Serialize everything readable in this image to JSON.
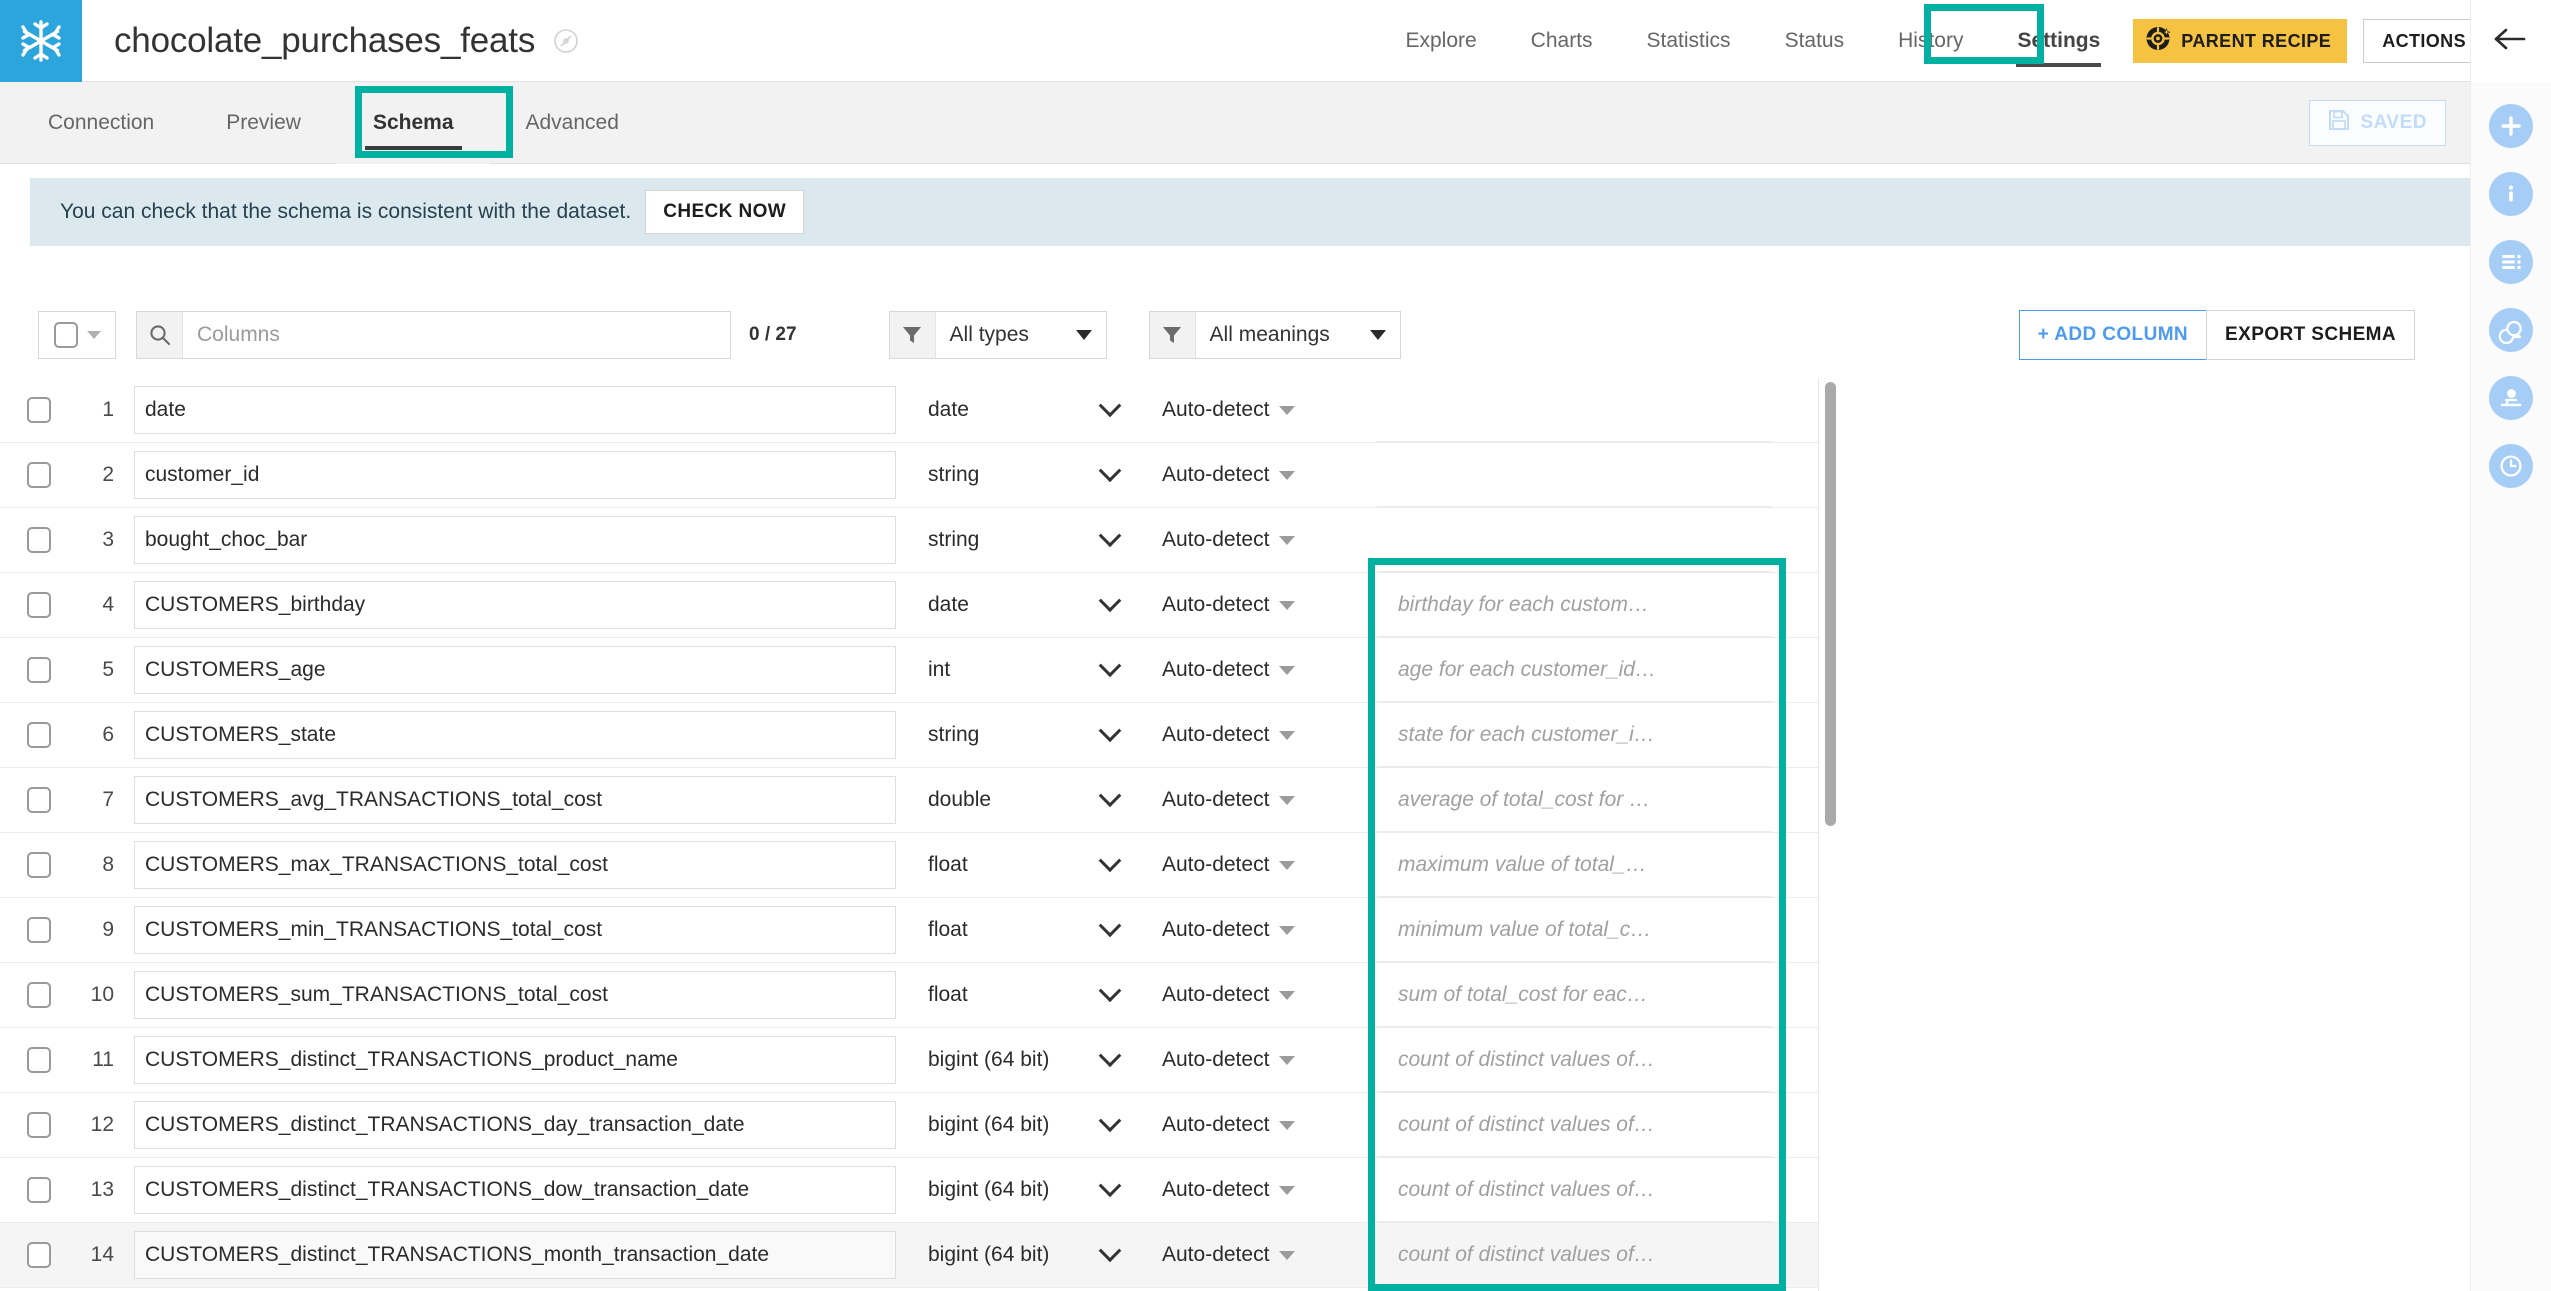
{
  "app": {
    "logo_icon": "snowflake-icon",
    "title": "chocolate_purchases_feats",
    "title_badge_icon": "compass-badge-icon",
    "accent_teal": "#00b0a0",
    "logo_bg": "#2ca5dd",
    "parent_recipe_bg": "#f5c242",
    "add_column_color": "#4d9bf0"
  },
  "topnav": {
    "items": [
      {
        "label": "Explore",
        "active": false
      },
      {
        "label": "Charts",
        "active": false
      },
      {
        "label": "Statistics",
        "active": false
      },
      {
        "label": "Status",
        "active": false
      },
      {
        "label": "History",
        "active": false
      },
      {
        "label": "Settings",
        "active": true
      }
    ],
    "parent_recipe_label": "PARENT RECIPE",
    "parent_recipe_icon": "gear-sparkle-icon",
    "actions_label": "ACTIONS",
    "back_arrow_icon": "arrow-left-icon"
  },
  "subtabs": {
    "items": [
      {
        "label": "Connection",
        "active": false
      },
      {
        "label": "Preview",
        "active": false
      },
      {
        "label": "Schema",
        "active": true
      },
      {
        "label": "Advanced",
        "active": false
      }
    ],
    "saved_label": "SAVED",
    "saved_icon": "floppy-disk-icon"
  },
  "banner": {
    "text": "You can check that the schema is consistent with the dataset.",
    "button_label": "CHECK NOW"
  },
  "toolbar": {
    "select_all_icon": "checkbox-icon",
    "select_all_caret_icon": "caret-down-icon",
    "search_icon": "search-icon",
    "search_placeholder": "Columns",
    "search_value": "",
    "count": "0 / 27",
    "filter_icon": "filter-funnel-icon",
    "types_filter": "All types",
    "meanings_filter": "All meanings",
    "add_column_label": "+ ADD COLUMN",
    "export_schema_label": "EXPORT SCHEMA"
  },
  "table": {
    "rows": [
      {
        "num": "1",
        "name": "date",
        "type": "date",
        "meaning": "Auto-detect",
        "desc": ""
      },
      {
        "num": "2",
        "name": "customer_id",
        "type": "string",
        "meaning": "Auto-detect",
        "desc": ""
      },
      {
        "num": "3",
        "name": "bought_choc_bar",
        "type": "string",
        "meaning": "Auto-detect",
        "desc": ""
      },
      {
        "num": "4",
        "name": "CUSTOMERS_birthday",
        "type": "date",
        "meaning": "Auto-detect",
        "desc": "birthday for each custom…"
      },
      {
        "num": "5",
        "name": "CUSTOMERS_age",
        "type": "int",
        "meaning": "Auto-detect",
        "desc": "age for each customer_id…"
      },
      {
        "num": "6",
        "name": "CUSTOMERS_state",
        "type": "string",
        "meaning": "Auto-detect",
        "desc": "state for each customer_i…"
      },
      {
        "num": "7",
        "name": "CUSTOMERS_avg_TRANSACTIONS_total_cost",
        "type": "double",
        "meaning": "Auto-detect",
        "desc": "average of total_cost for …"
      },
      {
        "num": "8",
        "name": "CUSTOMERS_max_TRANSACTIONS_total_cost",
        "type": "float",
        "meaning": "Auto-detect",
        "desc": "maximum value of total_…"
      },
      {
        "num": "9",
        "name": "CUSTOMERS_min_TRANSACTIONS_total_cost",
        "type": "float",
        "meaning": "Auto-detect",
        "desc": "minimum value of total_c…"
      },
      {
        "num": "10",
        "name": "CUSTOMERS_sum_TRANSACTIONS_total_cost",
        "type": "float",
        "meaning": "Auto-detect",
        "desc": "sum of total_cost for eac…"
      },
      {
        "num": "11",
        "name": "CUSTOMERS_distinct_TRANSACTIONS_product_name",
        "type": "bigint (64 bit)",
        "meaning": "Auto-detect",
        "desc": "count of distinct values of…"
      },
      {
        "num": "12",
        "name": "CUSTOMERS_distinct_TRANSACTIONS_day_transaction_date",
        "type": "bigint (64 bit)",
        "meaning": "Auto-detect",
        "desc": "count of distinct values of…"
      },
      {
        "num": "13",
        "name": "CUSTOMERS_distinct_TRANSACTIONS_dow_transaction_date",
        "type": "bigint (64 bit)",
        "meaning": "Auto-detect",
        "desc": "count of distinct values of…"
      },
      {
        "num": "14",
        "name": "CUSTOMERS_distinct_TRANSACTIONS_month_transaction_date",
        "type": "bigint (64 bit)",
        "meaning": "Auto-detect",
        "desc": "count of distinct values of…"
      }
    ]
  },
  "rail": {
    "icons": [
      "plus-icon",
      "info-icon",
      "details-list-icon",
      "chat-bubbles-icon",
      "lab-microscope-icon",
      "clock-history-icon"
    ]
  }
}
